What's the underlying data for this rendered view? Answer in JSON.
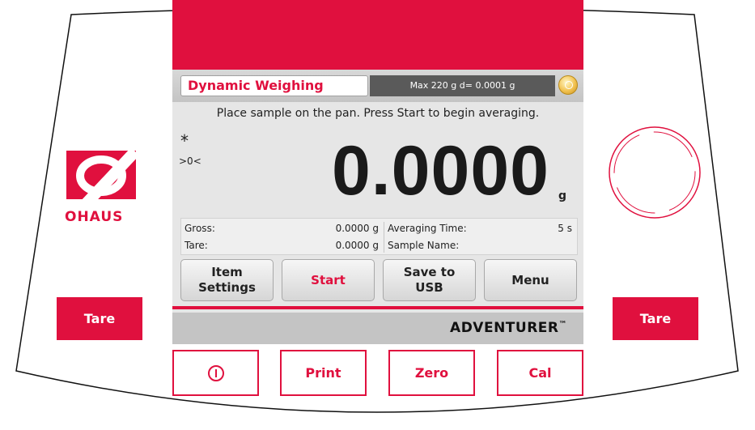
{
  "colors": {
    "accent": "#e0103e",
    "screen_bg": "#e6e6e6",
    "capacity_bg": "#5a5a5a"
  },
  "logo": {
    "text": "OHAUS",
    "icon": "ohaus-logo-icon"
  },
  "side_buttons": {
    "left_tare": "Tare",
    "right_tare": "Tare"
  },
  "bottom_buttons": {
    "power_icon": "power-icon",
    "print": "Print",
    "zero": "Zero",
    "cal": "Cal"
  },
  "screen": {
    "title": "Dynamic Weighing",
    "capacity": "Max 220 g  d= 0.0001 g",
    "status_icon": "level-bubble-icon",
    "instruction": "Place sample on the pan.  Press Start to begin averaging.",
    "stability_indicator": "*",
    "center_zero_indicator": ">0<",
    "reading": "0.0000",
    "unit": "g",
    "info": {
      "gross_label": "Gross:",
      "gross_value": "0.0000 g",
      "tare_label": "Tare:",
      "tare_value": "0.0000 g",
      "averaging_time_label": "Averaging Time:",
      "averaging_time_value": "5 s",
      "sample_name_label": "Sample Name:",
      "sample_name_value": ""
    },
    "softkeys": {
      "item_settings_line1": "Item",
      "item_settings_line2": "Settings",
      "start": "Start",
      "save_line1": "Save to",
      "save_line2": "USB",
      "menu": "Menu"
    },
    "brand": "ADVENTURER",
    "brand_tm": "™"
  }
}
